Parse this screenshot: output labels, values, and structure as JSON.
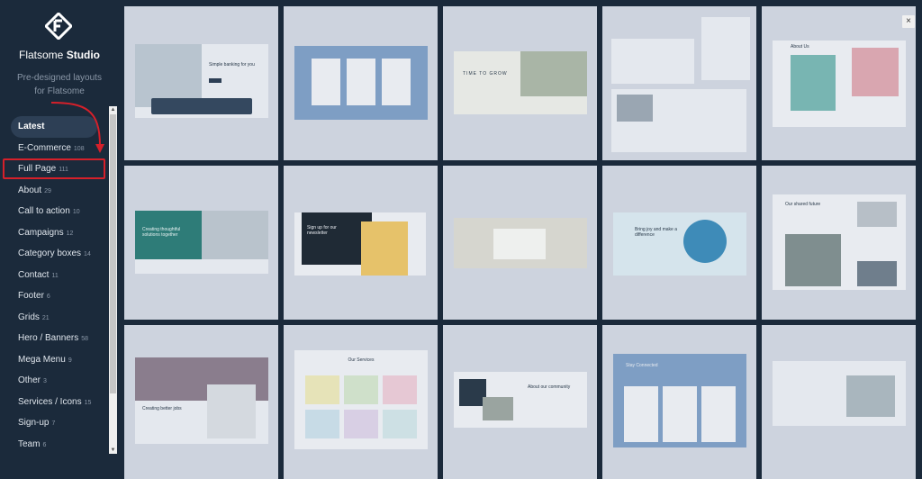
{
  "sidebar": {
    "brand_name": "Flatsome",
    "brand_suffix": "Studio",
    "tagline_line1": "Pre-designed layouts",
    "tagline_line2": "for Flatsome",
    "items": [
      {
        "label": "Latest",
        "count": ""
      },
      {
        "label": "E-Commerce",
        "count": "108"
      },
      {
        "label": "Full Page",
        "count": "111"
      },
      {
        "label": "About",
        "count": "29"
      },
      {
        "label": "Call to action",
        "count": "10"
      },
      {
        "label": "Campaigns",
        "count": "12"
      },
      {
        "label": "Category boxes",
        "count": "14"
      },
      {
        "label": "Contact",
        "count": "11"
      },
      {
        "label": "Footer",
        "count": "6"
      },
      {
        "label": "Grids",
        "count": "21"
      },
      {
        "label": "Hero / Banners",
        "count": "58"
      },
      {
        "label": "Mega Menu",
        "count": "9"
      },
      {
        "label": "Other",
        "count": "3"
      },
      {
        "label": "Services / Icons",
        "count": "15"
      },
      {
        "label": "Sign-up",
        "count": "7"
      },
      {
        "label": "Team",
        "count": "6"
      }
    ]
  },
  "close_label": "×",
  "colors": {
    "sidebar_bg": "#1b2a3b",
    "highlight": "#d6202a",
    "tile_bg": "#cdd3de"
  },
  "tiles": [
    {
      "heading": "Simple banking for you"
    },
    {
      "heading": ""
    },
    {
      "heading": "TIME TO GROW"
    },
    {
      "heading": ""
    },
    {
      "heading": "About Us"
    },
    {
      "heading": "Creating thoughtful solutions together"
    },
    {
      "heading": "Sign up for our newsletter"
    },
    {
      "heading": ""
    },
    {
      "heading": "Bring joy and make a difference"
    },
    {
      "heading": "Our shared future"
    },
    {
      "heading": "Creating better jobs"
    },
    {
      "heading": "Our Services"
    },
    {
      "heading": "About our community"
    },
    {
      "heading": "Stay Connected"
    },
    {
      "heading": ""
    }
  ]
}
